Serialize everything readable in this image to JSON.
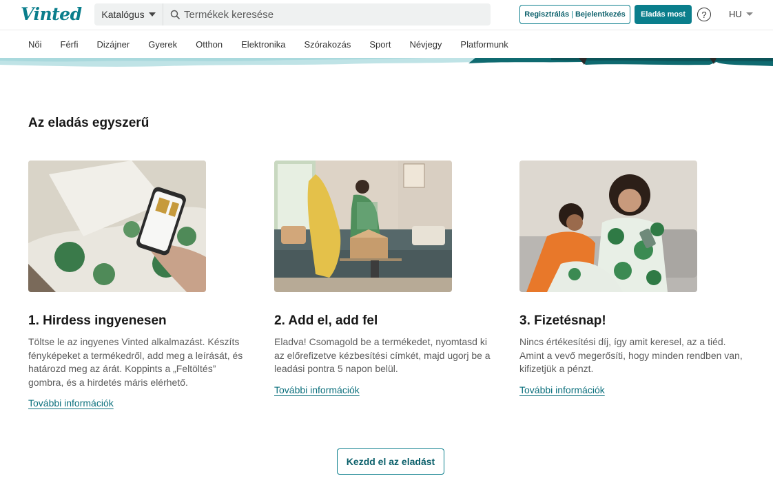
{
  "header": {
    "logo": "Vinted",
    "catalog_label": "Katalógus",
    "search_placeholder": "Termékek keresése",
    "register_label": "Regisztrálás",
    "auth_separator": "|",
    "login_label": "Bejelentkezés",
    "sell_label": "Eladás most",
    "help_label": "?",
    "language": "HU"
  },
  "nav": {
    "items": [
      "Női",
      "Férfi",
      "Dizájner",
      "Gyerek",
      "Otthon",
      "Elektronika",
      "Szórakozás",
      "Sport",
      "Névjegy",
      "Platformunk"
    ]
  },
  "section": {
    "title": "Az eladás egyszerű",
    "cards": [
      {
        "heading": "1. Hirdess ingyenesen",
        "text": "Töltse le az ingyenes Vinted alkalmazást. Készíts fényképeket a termékedről, add meg a leírását, és határozd meg az árát. Koppints a „Feltöltés” gombra, és a hirdetés máris elérhető.",
        "link": "További információk"
      },
      {
        "heading": "2. Add el, add fel",
        "text": "Eladva! Csomagold be a termékedet, nyomtasd ki az előrefizetve kézbesítési címkét, majd ugorj be a leadási pontra 5 napon belül.",
        "link": "További információk"
      },
      {
        "heading": "3. Fizetésnap!",
        "text": "Nincs értékesítési díj, így amit keresel, az a tiéd. Amint a vevő megerősíti, hogy minden rendben van, kifizetjük a pénzt.",
        "link": "További információk"
      }
    ],
    "cta_label": "Kezdd el az eladást"
  },
  "colors": {
    "brand": "#0a7e8c",
    "text": "#171717",
    "muted_text": "#5c5c5c"
  }
}
